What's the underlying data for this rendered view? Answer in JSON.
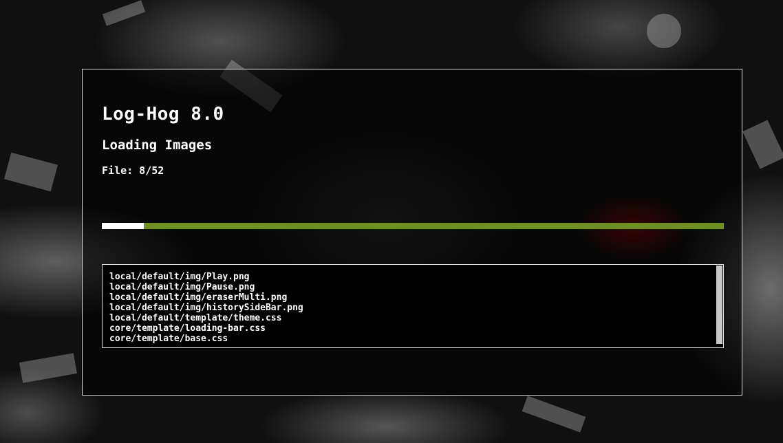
{
  "app": {
    "title": "Log-Hog 8.0"
  },
  "loading": {
    "stage": "Loading Images",
    "file_counter": "File: 8/52",
    "progress_fraction": 0.0675,
    "colors": {
      "track": "#6f8f22",
      "fill": "#ffffff"
    }
  },
  "file_log": {
    "files": [
      "local/default/img/Play.png",
      "local/default/img/Pause.png",
      "local/default/img/eraserMulti.png",
      "local/default/img/historySideBar.png",
      "local/default/template/theme.css",
      "core/template/loading-bar.css",
      "core/template/base.css"
    ]
  }
}
